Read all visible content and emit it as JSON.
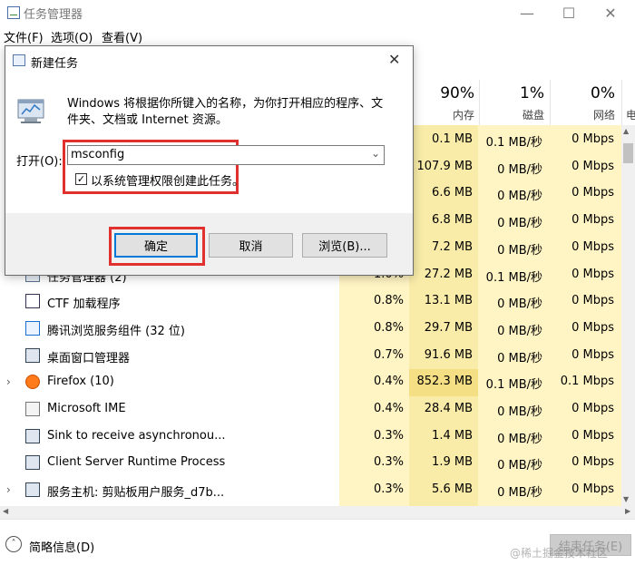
{
  "window": {
    "title": "任务管理器"
  },
  "menu": [
    "文件(F)",
    "选项(O)",
    "查看(V)"
  ],
  "columns": [
    {
      "pct": "90%",
      "label": "内存"
    },
    {
      "pct": "1%",
      "label": "磁盘"
    },
    {
      "pct": "0%",
      "label": "网络"
    },
    {
      "pct": "",
      "label": "电"
    }
  ],
  "rows": [
    {
      "name": "",
      "cpu": "",
      "mem": "0.1 MB",
      "disk": "0.1 MB/秒",
      "net": "0 Mbps"
    },
    {
      "name": "",
      "cpu": "",
      "mem": "107.9 MB",
      "disk": "0 MB/秒",
      "net": "0 Mbps"
    },
    {
      "name": "",
      "cpu": "",
      "mem": "6.6 MB",
      "disk": "0 MB/秒",
      "net": "0 Mbps"
    },
    {
      "name": "",
      "cpu": "",
      "mem": "6.8 MB",
      "disk": "0 MB/秒",
      "net": "0 Mbps"
    },
    {
      "name": "",
      "cpu": "",
      "mem": "7.2 MB",
      "disk": "0 MB/秒",
      "net": "0 Mbps"
    },
    {
      "name": "任务管理器 (2)",
      "cpu": "1.0%",
      "mem": "27.2 MB",
      "disk": "0.1 MB/秒",
      "net": "0 Mbps"
    },
    {
      "name": "CTF 加载程序",
      "cpu": "0.8%",
      "mem": "13.1 MB",
      "disk": "0 MB/秒",
      "net": "0 Mbps"
    },
    {
      "name": "腾讯浏览服务组件 (32 位)",
      "cpu": "0.8%",
      "mem": "29.7 MB",
      "disk": "0 MB/秒",
      "net": "0 Mbps"
    },
    {
      "name": "桌面窗口管理器",
      "cpu": "0.7%",
      "mem": "91.6 MB",
      "disk": "0 MB/秒",
      "net": "0 Mbps"
    },
    {
      "name": "Firefox (10)",
      "cpu": "0.4%",
      "mem": "852.3 MB",
      "disk": "0.1 MB/秒",
      "net": "0.1 Mbps"
    },
    {
      "name": "Microsoft IME",
      "cpu": "0.4%",
      "mem": "28.4 MB",
      "disk": "0 MB/秒",
      "net": "0 Mbps"
    },
    {
      "name": "Sink to receive asynchronou...",
      "cpu": "0.3%",
      "mem": "1.4 MB",
      "disk": "0 MB/秒",
      "net": "0 Mbps"
    },
    {
      "name": "Client Server Runtime Process",
      "cpu": "0.3%",
      "mem": "1.9 MB",
      "disk": "0 MB/秒",
      "net": "0 Mbps"
    },
    {
      "name": "服务主机: 剪贴板用户服务_d7b...",
      "cpu": "0.3%",
      "mem": "5.6 MB",
      "disk": "0 MB/秒",
      "net": "0 Mbps"
    }
  ],
  "footer": {
    "brief_label": "简略信息(D)",
    "end_task_label": "结束任务(E)",
    "watermark": "@稀土掘金技术社区"
  },
  "dialog": {
    "title": "新建任务",
    "description": "Windows 将根据你所键入的名称，为你打开相应的程序、文件夹、文档或 Internet 资源。",
    "open_label": "打开(O):",
    "input_value": "msconfig",
    "admin_checkbox_label": "以系统管理权限创建此任务。",
    "admin_checked": true,
    "ok_label": "确定",
    "cancel_label": "取消",
    "browse_label": "浏览(B)..."
  },
  "colors": {
    "highlight_red": "#e0312f",
    "heat_light": "#fff4c4",
    "heat_mid": "#f9eca8",
    "heat_strong": "#f5df84"
  }
}
